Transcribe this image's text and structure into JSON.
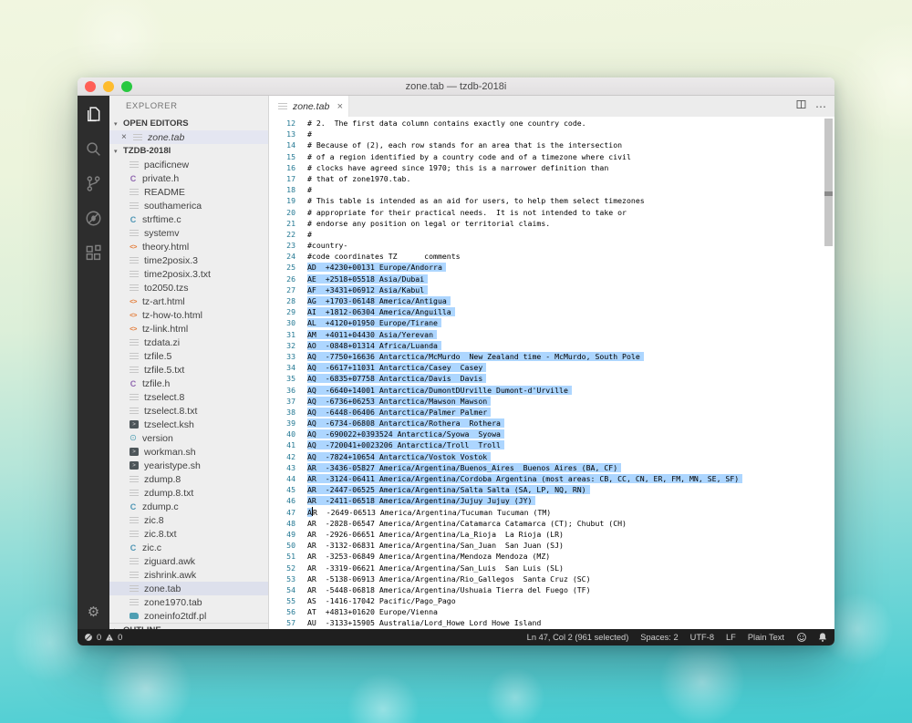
{
  "window": {
    "title": "zone.tab — tzdb-2018i"
  },
  "traffic_lights": {
    "close": "#ff5f57",
    "minimize": "#febc2e",
    "zoom": "#28c840"
  },
  "sidebar": {
    "title": "EXPLORER",
    "open_editors": {
      "header": "OPEN EDITORS",
      "item": {
        "close": "×",
        "label": "zone.tab",
        "icon": "doc"
      }
    },
    "folder": {
      "header": "TZDB-2018I",
      "files": [
        {
          "label": "pacificnew",
          "icon": "doc"
        },
        {
          "label": "private.h",
          "icon": "c_purple"
        },
        {
          "label": "README",
          "icon": "doc"
        },
        {
          "label": "southamerica",
          "icon": "doc"
        },
        {
          "label": "strftime.c",
          "icon": "c_blue"
        },
        {
          "label": "systemv",
          "icon": "doc"
        },
        {
          "label": "theory.html",
          "icon": "html"
        },
        {
          "label": "time2posix.3",
          "icon": "doc"
        },
        {
          "label": "time2posix.3.txt",
          "icon": "doc"
        },
        {
          "label": "to2050.tzs",
          "icon": "doc"
        },
        {
          "label": "tz-art.html",
          "icon": "html"
        },
        {
          "label": "tz-how-to.html",
          "icon": "html"
        },
        {
          "label": "tz-link.html",
          "icon": "html"
        },
        {
          "label": "tzdata.zi",
          "icon": "doc"
        },
        {
          "label": "tzfile.5",
          "icon": "doc"
        },
        {
          "label": "tzfile.5.txt",
          "icon": "doc"
        },
        {
          "label": "tzfile.h",
          "icon": "c_purple"
        },
        {
          "label": "tzselect.8",
          "icon": "doc"
        },
        {
          "label": "tzselect.8.txt",
          "icon": "doc"
        },
        {
          "label": "tzselect.ksh",
          "icon": "shell"
        },
        {
          "label": "version",
          "icon": "info"
        },
        {
          "label": "workman.sh",
          "icon": "shell"
        },
        {
          "label": "yearistype.sh",
          "icon": "shell"
        },
        {
          "label": "zdump.8",
          "icon": "doc"
        },
        {
          "label": "zdump.8.txt",
          "icon": "doc"
        },
        {
          "label": "zdump.c",
          "icon": "c_blue"
        },
        {
          "label": "zic.8",
          "icon": "doc"
        },
        {
          "label": "zic.8.txt",
          "icon": "doc"
        },
        {
          "label": "zic.c",
          "icon": "c_blue"
        },
        {
          "label": "ziguard.awk",
          "icon": "doc"
        },
        {
          "label": "zishrink.awk",
          "icon": "doc"
        },
        {
          "label": "zone.tab",
          "icon": "doc",
          "selected": true
        },
        {
          "label": "zone1970.tab",
          "icon": "doc"
        },
        {
          "label": "zoneinfo2tdf.pl",
          "icon": "perl"
        }
      ]
    },
    "outline": {
      "header": "OUTLINE"
    },
    "icon_glyphs": {
      "doc": "",
      "c_blue": "C",
      "c_purple": "C",
      "html": "<>",
      "shell": ">",
      "info": "⊙",
      "perl": ""
    },
    "arrows": {
      "expanded": "▾",
      "collapsed": "▸"
    }
  },
  "editor": {
    "tab": {
      "label": "zone.tab",
      "close": "×"
    },
    "colors": {
      "selection": "#add6ff",
      "line_number": "#237893"
    },
    "selection_note": "lines 25-46 fully selected; line 47 first char selected, cursor at col 2",
    "lines": [
      {
        "n": 12,
        "t": "# 2.  The first data column contains exactly one country code."
      },
      {
        "n": 13,
        "t": "#"
      },
      {
        "n": 14,
        "t": "# Because of (2), each row stands for an area that is the intersection"
      },
      {
        "n": 15,
        "t": "# of a region identified by a country code and of a timezone where civil"
      },
      {
        "n": 16,
        "t": "# clocks have agreed since 1970; this is a narrower definition than"
      },
      {
        "n": 17,
        "t": "# that of zone1970.tab."
      },
      {
        "n": 18,
        "t": "#"
      },
      {
        "n": 19,
        "t": "# This table is intended as an aid for users, to help them select timezones"
      },
      {
        "n": 20,
        "t": "# appropriate for their practical needs.  It is not intended to take or"
      },
      {
        "n": 21,
        "t": "# endorse any position on legal or territorial claims."
      },
      {
        "n": 22,
        "t": "#"
      },
      {
        "n": 23,
        "t": "#country-"
      },
      {
        "n": 24,
        "t": "#code coordinates TZ      comments"
      },
      {
        "n": 25,
        "t": "AD  +4230+00131 Europe/Andorra",
        "sel": "full"
      },
      {
        "n": 26,
        "t": "AE  +2518+05518 Asia/Dubai",
        "sel": "full"
      },
      {
        "n": 27,
        "t": "AF  +3431+06912 Asia/Kabul",
        "sel": "full"
      },
      {
        "n": 28,
        "t": "AG  +1703-06148 America/Antigua",
        "sel": "full"
      },
      {
        "n": 29,
        "t": "AI  +1812-06304 America/Anguilla",
        "sel": "full"
      },
      {
        "n": 30,
        "t": "AL  +4120+01950 Europe/Tirane",
        "sel": "full"
      },
      {
        "n": 31,
        "t": "AM  +4011+04430 Asia/Yerevan",
        "sel": "full"
      },
      {
        "n": 32,
        "t": "AO  -0848+01314 Africa/Luanda",
        "sel": "full"
      },
      {
        "n": 33,
        "t": "AQ  -7750+16636 Antarctica/McMurdo  New Zealand time - McMurdo, South Pole",
        "sel": "full"
      },
      {
        "n": 34,
        "t": "AQ  -6617+11031 Antarctica/Casey  Casey",
        "sel": "full"
      },
      {
        "n": 35,
        "t": "AQ  -6835+07758 Antarctica/Davis  Davis",
        "sel": "full"
      },
      {
        "n": 36,
        "t": "AQ  -6640+14001 Antarctica/DumontDUrville Dumont-d'Urville",
        "sel": "full"
      },
      {
        "n": 37,
        "t": "AQ  -6736+06253 Antarctica/Mawson Mawson",
        "sel": "full"
      },
      {
        "n": 38,
        "t": "AQ  -6448-06406 Antarctica/Palmer Palmer",
        "sel": "full"
      },
      {
        "n": 39,
        "t": "AQ  -6734-06808 Antarctica/Rothera  Rothera",
        "sel": "full"
      },
      {
        "n": 40,
        "t": "AQ  -690022+0393524 Antarctica/Syowa  Syowa",
        "sel": "full"
      },
      {
        "n": 41,
        "t": "AQ  -720041+0023206 Antarctica/Troll  Troll",
        "sel": "full"
      },
      {
        "n": 42,
        "t": "AQ  -7824+10654 Antarctica/Vostok Vostok",
        "sel": "full"
      },
      {
        "n": 43,
        "t": "AR  -3436-05827 America/Argentina/Buenos_Aires  Buenos Aires (BA, CF)",
        "sel": "full"
      },
      {
        "n": 44,
        "t": "AR  -3124-06411 America/Argentina/Cordoba Argentina (most areas: CB, CC, CN, ER, FM, MN, SE, SF)",
        "sel": "full"
      },
      {
        "n": 45,
        "t": "AR  -2447-06525 America/Argentina/Salta Salta (SA, LP, NQ, RN)",
        "sel": "full"
      },
      {
        "n": 46,
        "t": "AR  -2411-06518 America/Argentina/Jujuy Jujuy (JY)",
        "sel": "full"
      },
      {
        "n": 47,
        "t": "AR  -2649-06513 America/Argentina/Tucuman Tucuman (TM)",
        "sel": "partial"
      },
      {
        "n": 48,
        "t": "AR  -2828-06547 America/Argentina/Catamarca Catamarca (CT); Chubut (CH)"
      },
      {
        "n": 49,
        "t": "AR  -2926-06651 America/Argentina/La_Rioja  La Rioja (LR)"
      },
      {
        "n": 50,
        "t": "AR  -3132-06831 America/Argentina/San_Juan  San Juan (SJ)"
      },
      {
        "n": 51,
        "t": "AR  -3253-06849 America/Argentina/Mendoza Mendoza (MZ)"
      },
      {
        "n": 52,
        "t": "AR  -3319-06621 America/Argentina/San_Luis  San Luis (SL)"
      },
      {
        "n": 53,
        "t": "AR  -5138-06913 America/Argentina/Rio_Gallegos  Santa Cruz (SC)"
      },
      {
        "n": 54,
        "t": "AR  -5448-06818 America/Argentina/Ushuaia Tierra del Fuego (TF)"
      },
      {
        "n": 55,
        "t": "AS  -1416-17042 Pacific/Pago_Pago"
      },
      {
        "n": 56,
        "t": "AT  +4813+01620 Europe/Vienna"
      },
      {
        "n": 57,
        "t": "AU  -3133+15905 Australia/Lord_Howe Lord Howe Island"
      }
    ]
  },
  "status_bar": {
    "errors": "0",
    "warnings": "0",
    "right_items": [
      "Ln 47, Col 2 (961 selected)",
      "Spaces: 2",
      "UTF-8",
      "LF",
      "Plain Text"
    ]
  }
}
